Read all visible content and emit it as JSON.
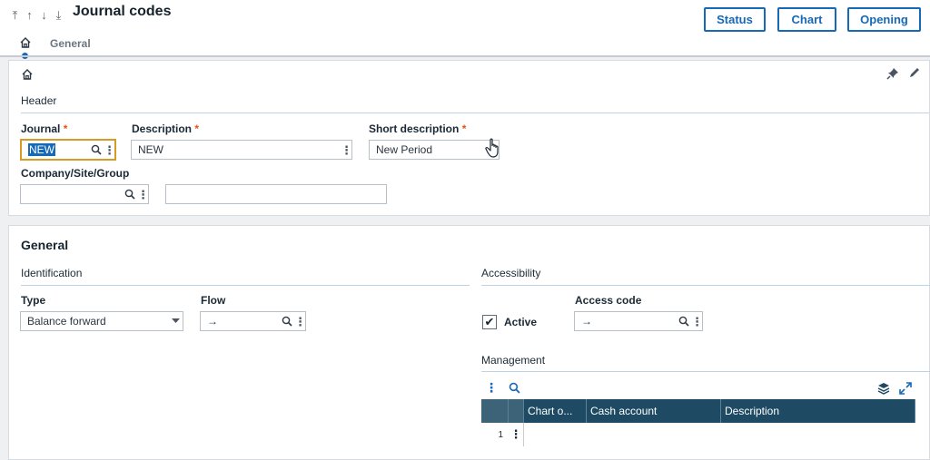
{
  "topbar": {
    "nav_arrows": [
      "⤒",
      "↑",
      "↓",
      "⤓"
    ],
    "title": "Journal codes",
    "buttons": {
      "status": "Status",
      "chart": "Chart",
      "opening": "Opening"
    }
  },
  "tabs": {
    "general": "General"
  },
  "header_section": {
    "title": "Header",
    "journal": {
      "label": "Journal",
      "value": "NEW"
    },
    "description": {
      "label": "Description",
      "value": "NEW"
    },
    "short_description": {
      "label": "Short description",
      "value": "New Period"
    },
    "company": {
      "label": "Company/Site/Group",
      "value": "",
      "extra_value": ""
    },
    "required_mark": "*"
  },
  "general_section": {
    "title": "General",
    "identification": {
      "title": "Identification",
      "type": {
        "label": "Type",
        "value": "Balance forward"
      },
      "flow": {
        "label": "Flow",
        "value": "→"
      }
    },
    "accessibility": {
      "title": "Accessibility",
      "active": {
        "label": "Active",
        "checked": true,
        "mark": "✔"
      },
      "access_code": {
        "label": "Access code",
        "value": "→"
      }
    },
    "management": {
      "title": "Management",
      "columns": [
        "Chart o...",
        "Cash account",
        "Description"
      ],
      "rows": [
        {
          "num": "1"
        }
      ]
    }
  },
  "colors": {
    "accent": "#1669b6",
    "grid_header": "#1e4b63",
    "focus": "#d69a25",
    "required": "#e5531a"
  },
  "icons": [
    "home-icon",
    "search-icon",
    "more-vertical-icon",
    "pin-icon",
    "pencil-icon",
    "layers-icon",
    "expand-icon",
    "chevron-down-icon",
    "hand-cursor-icon"
  ]
}
